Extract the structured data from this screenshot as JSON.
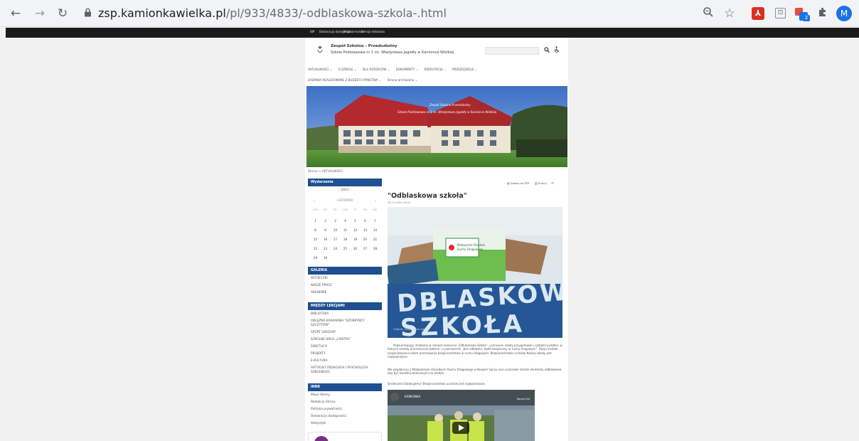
{
  "browser": {
    "url_host": "zsp.kamionkawielka.pl",
    "url_path": "/pl/933/4833/-odblaskowa-szkola-.html",
    "profile_initial": "M",
    "extension_badge": "2",
    "icons": [
      "back-icon",
      "forward-icon",
      "reload-icon",
      "lock-icon",
      "zoom-icon",
      "star-icon",
      "acrobat-icon",
      "extension-icon",
      "multi-extension-icon",
      "puzzle-icon"
    ]
  },
  "topbar": {
    "links": [
      "BIP",
      "Deklaracja dostępności",
      "Mapa serwisu",
      "Wersja tekstowa"
    ]
  },
  "header": {
    "school_name": "Zespół Szkolno - Przedszkolny",
    "school_sub": "Szkoła Podstawowa nr 1 im. Władysława Jagiełły w Kamionce Wielkiej"
  },
  "menu": {
    "row1": [
      "AKTUALNOŚCI ⌄",
      "O SZKOLE ⌄",
      "DLA RODZICÓW ⌄",
      "DOKUMENTY ⌄",
      "REKRUTACJA ⌄",
      "PRZEDSZKOLE ⌄"
    ],
    "row2": [
      "ZADANIA REALIZOWANE Z BUDŻETU PAŃSTWA ⌄",
      "Strona archiwalna ⌄"
    ]
  },
  "banner": {
    "caption1": "Zespół Szkolno-Przedszkolny",
    "caption2": "Szkoła Podstawowa nr 1 im. Władysława Jagiełły w Kamionce Wielkiej"
  },
  "breadcrumb": "Strona > AKTUALNOŚCI",
  "calendar": {
    "heading": "Wydarzenia",
    "year": "‹   2021   ›",
    "month": "LISTOPAD",
    "dow": [
      "PON",
      "WT",
      "ŚR",
      "CZW",
      "PT",
      "SB",
      "ND"
    ],
    "days": [
      "1",
      "2",
      "3",
      "4",
      "5",
      "6",
      "7",
      "8",
      "9",
      "10",
      "11",
      "12",
      "13",
      "14",
      "15",
      "16",
      "17",
      "18",
      "19",
      "20",
      "21",
      "22",
      "23",
      "24",
      "25",
      "26",
      "27",
      "28",
      "29",
      "30"
    ]
  },
  "galeria": {
    "heading": "GALERIA",
    "items": [
      "WYCIECZKI",
      "NASZE PRACE",
      "AKADEMIE"
    ]
  },
  "lekcje": {
    "heading": "MIĘDZY LEKCJAMI",
    "items": [
      "BIBLIOTEKA",
      "OBLĘŻNA KAWIARNIA \"SZOBRYNCY SZCZYTÓW\"",
      "SPORT SZKOLNY",
      "SZKOLNE KOŁO „CARITAS”",
      "ŚWIETLICA",
      "PROJEKTY",
      "E-KULTURA",
      "ARTYKUŁY PEDAGOGA I PSYCHOLOGA SZKOLNEGO"
    ]
  },
  "inne": {
    "heading": "INNE",
    "items": [
      "Mapa Strony",
      "Redakcja Strony",
      "Polityka prywatności",
      "Deklaracja dostępności",
      "Statystyki"
    ]
  },
  "article": {
    "pdf_label": "Zapisz do PDF",
    "print_label": "Drukuj",
    "title": "\"Odblaskowa szkoła\"",
    "date": "26.11.2021 10:24",
    "photo_caption": "Zdjęcie: Odblaskowa szkoła",
    "para1": "Podsumowując działania w ramach konkursu „Odblaskowa Szkoła”, uczniowie szkoły przygotowali i ozdobili pudełka, w których zostały umieszczone baterie i z pokrowcem „bez odblasku, bądź bezpieczny w ruchu drogowym”. Akcja została zorganizowana celem promowania bezpieczeństwa w ruchu drogowym. Bezpieczeństwo uczniów Naszej szkoły jest najważniejsze.",
    "para2": "We współpracy z Małopolskim Ośrodkiem Ruchu Drogowego w Nowym Sączu nasi uczniowie dostali elementy odblaskowe, aby być bardziej widocznymi na drodze.",
    "para3": "Serdecznie Dziękujemy! Bezpieczeństwo uczniów jest najważniejsze.",
    "video_title": "KAMIONKA",
    "video_share": "Kopiuj link"
  },
  "colors": {
    "sidebar_header": "#1d4f91",
    "page_background": "#ffffff",
    "browser_chrome": "#f2f3f4"
  }
}
